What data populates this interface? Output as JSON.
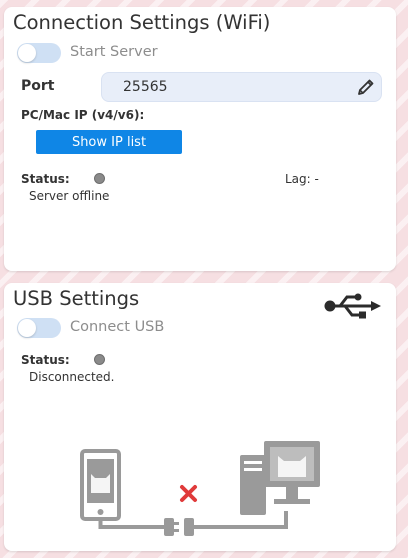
{
  "wifi": {
    "title": "Connection Settings (WiFi)",
    "toggle_label": "Start Server",
    "toggle_on": false,
    "port_label": "Port",
    "port_value": "25565",
    "ip_label": "PC/Mac IP (v4/v6):",
    "show_ip_button_label": "Show IP list",
    "status_label": "Status:",
    "status_text": "Server offline",
    "lag_text": "Lag: -"
  },
  "usb": {
    "title": "USB Settings",
    "toggle_label": "Connect USB",
    "toggle_on": false,
    "status_label": "Status:",
    "status_text": "Disconnected."
  },
  "icons": {
    "edit": "pencil-icon",
    "usb": "usb-icon",
    "status": "status-dot-icon",
    "disconnected": "x-mark-icon"
  },
  "colors": {
    "accent_button": "#0f86e6",
    "toggle_off": "#cfe0f4",
    "status_offline": "#8a8a8a",
    "disconnect_mark": "#e03a3a",
    "illustration_gray": "#9a9a9a",
    "background": "#f6dfe2"
  }
}
